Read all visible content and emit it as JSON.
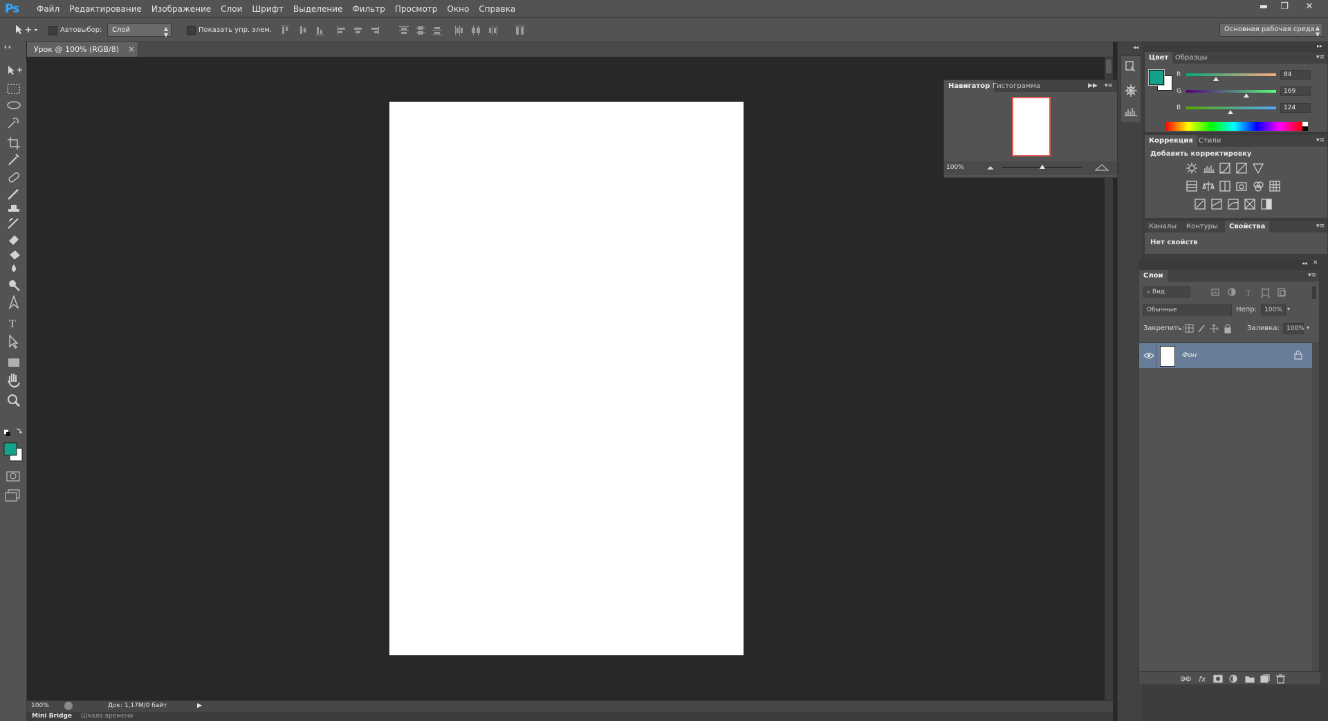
{
  "app": {
    "logo": "Ps"
  },
  "menu": [
    "Файл",
    "Редактирование",
    "Изображение",
    "Слои",
    "Шрифт",
    "Выделение",
    "Фильтр",
    "Просмотр",
    "Окно",
    "Справка"
  ],
  "window_controls": {
    "minimize": "▬",
    "restore": "❐",
    "close": "✕"
  },
  "options": {
    "autoselect_label": "Автовыбор:",
    "autoselect_value": "Слой",
    "show_transform_label": "Показать упр. элем.",
    "workspace": "Основная рабочая среда"
  },
  "document": {
    "tab_label": "Урок @ 100% (RGB/8)",
    "tab_close": "×",
    "zoom": "100%",
    "doc_info": "Док: 1,17M/0 байт",
    "status_arrow": "▶"
  },
  "bottom_tabs": [
    "Mini Bridge",
    "Шкала времени"
  ],
  "navigator": {
    "tabs": [
      "Навигатор",
      "Гистограмма"
    ],
    "zoom": "100%"
  },
  "color_panel": {
    "tabs": [
      "Цвет",
      "Образцы"
    ],
    "channels": [
      {
        "label": "R",
        "value": "84",
        "fraction": 0.33
      },
      {
        "label": "G",
        "value": "169",
        "fraction": 0.66
      },
      {
        "label": "B",
        "value": "124",
        "fraction": 0.49
      }
    ],
    "foreground": "#54a97c",
    "background": "#ffffff"
  },
  "adjustments_panel": {
    "tabs": [
      "Коррекция",
      "Стили"
    ],
    "heading": "Добавить корректировку"
  },
  "properties_panel": {
    "tabs": [
      "Каналы",
      "Контуры",
      "Свойства"
    ],
    "message": "Нет свойств"
  },
  "layers_panel": {
    "tab": "Слои",
    "filter_label": "Вид",
    "blend_mode": "Обычные",
    "opacity_label": "Непр:",
    "opacity_value": "100%",
    "lock_label": "Закрепить:",
    "fill_label": "Заливка:",
    "fill_value": "100%",
    "layers": [
      {
        "name": "Фон",
        "locked": true,
        "visible": true
      }
    ]
  },
  "icons": {
    "tools": [
      "move-icon",
      "marquee-icon",
      "lasso-icon",
      "quick-select-icon",
      "crop-icon",
      "eyedropper-icon",
      "healing-icon",
      "brush-icon",
      "stamp-icon",
      "history-brush-icon",
      "eraser-icon",
      "paint-bucket-icon",
      "blur-icon",
      "dodge-icon",
      "pen-icon",
      "type-icon",
      "path-select-icon",
      "rectangle-icon",
      "hand-icon",
      "zoom-icon"
    ]
  }
}
